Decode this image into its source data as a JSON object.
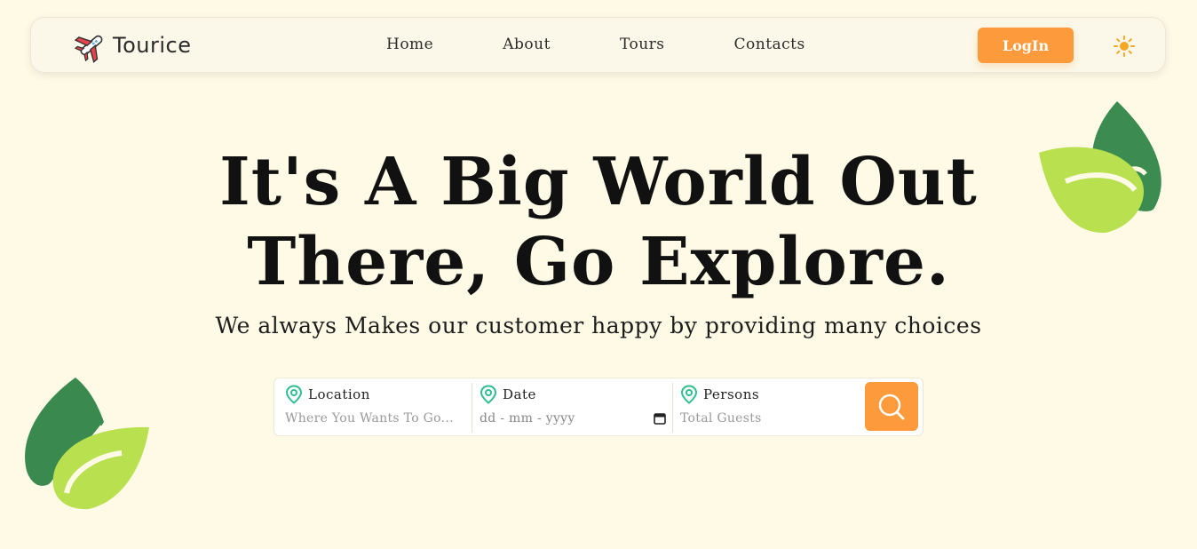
{
  "brand": {
    "name": "Tourice",
    "logo_icon": "airplane-icon"
  },
  "nav": {
    "links": [
      "Home",
      "About",
      "Tours",
      "Contacts"
    ],
    "login_label": "LogIn",
    "theme_icon": "sun-icon"
  },
  "hero": {
    "title_line1": "It's A Big World Out",
    "title_line2": "There, Go Explore.",
    "subtitle": "We always Makes our customer happy by providing many choices"
  },
  "search": {
    "location": {
      "label": "Location",
      "placeholder": "Where You Wants To Go..."
    },
    "date": {
      "label": "Date",
      "placeholder": "dd - mm - yyyy"
    },
    "persons": {
      "label": "Persons",
      "placeholder": "Total Guests"
    },
    "button_icon": "search-icon"
  },
  "colors": {
    "background": "#fefae6",
    "accent": "#fc9a3c",
    "pin": "#2fbf8f",
    "leaf_dark": "#3a8a4f",
    "leaf_light": "#b8e04f"
  }
}
